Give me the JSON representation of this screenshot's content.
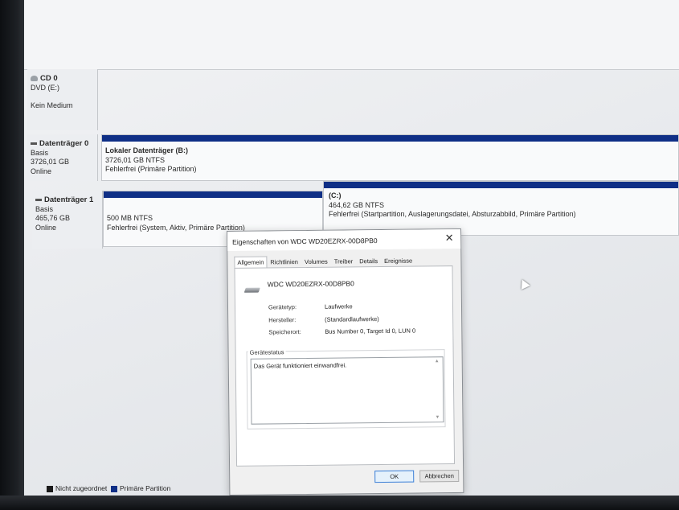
{
  "disks": {
    "cd0": {
      "title": "CD 0",
      "type": "DVD (E:)",
      "status": "Kein Medium"
    },
    "disk0": {
      "title": "Datenträger 0",
      "type": "Basis",
      "size": "3726,01 GB",
      "state": "Online",
      "partitions": [
        {
          "name": "Lokaler Datenträger  (B:)",
          "size": "3726,01 GB NTFS",
          "status": "Fehlerfrei (Primäre Partition)"
        }
      ]
    },
    "disk1": {
      "title": "Datenträger 1",
      "type": "Basis",
      "size": "465,76 GB",
      "state": "Online",
      "partitions": [
        {
          "name": "",
          "size": "500 MB NTFS",
          "status": "Fehlerfrei (System, Aktiv, Primäre Partition)"
        },
        {
          "name": "(C:)",
          "size": "464,62 GB NTFS",
          "status": "Fehlerfrei (Startpartition, Auslagerungsdatei, Absturzabbild, Primäre Partition)"
        }
      ]
    }
  },
  "legend": {
    "unallocated": "Nicht zugeordnet",
    "primary": "Primäre Partition",
    "unallocated_color": "#1a1a1a",
    "primary_color": "#0f2f86"
  },
  "dialog": {
    "title": "Eigenschaften von WDC WD20EZRX-00D8PB0",
    "close": "✕",
    "tabs": [
      "Allgemein",
      "Richtlinien",
      "Volumes",
      "Treiber",
      "Details",
      "Ereignisse"
    ],
    "device_name": "WDC WD20EZRX-00D8PB0",
    "props": {
      "type_label": "Gerätetyp:",
      "type_value": "Laufwerke",
      "maker_label": "Hersteller:",
      "maker_value": "(Standardlaufwerke)",
      "location_label": "Speicherort:",
      "location_value": "Bus Number 0, Target Id 0, LUN 0"
    },
    "status_group": "Gerätestatus",
    "status_text": "Das Gerät funktioniert einwandfrei.",
    "ok": "OK",
    "cancel": "Abbrechen"
  },
  "icons": {
    "disk": "disk-icon",
    "cd": "cd-icon",
    "device": "hard-drive-icon",
    "cursor": "mouse-cursor-icon"
  }
}
